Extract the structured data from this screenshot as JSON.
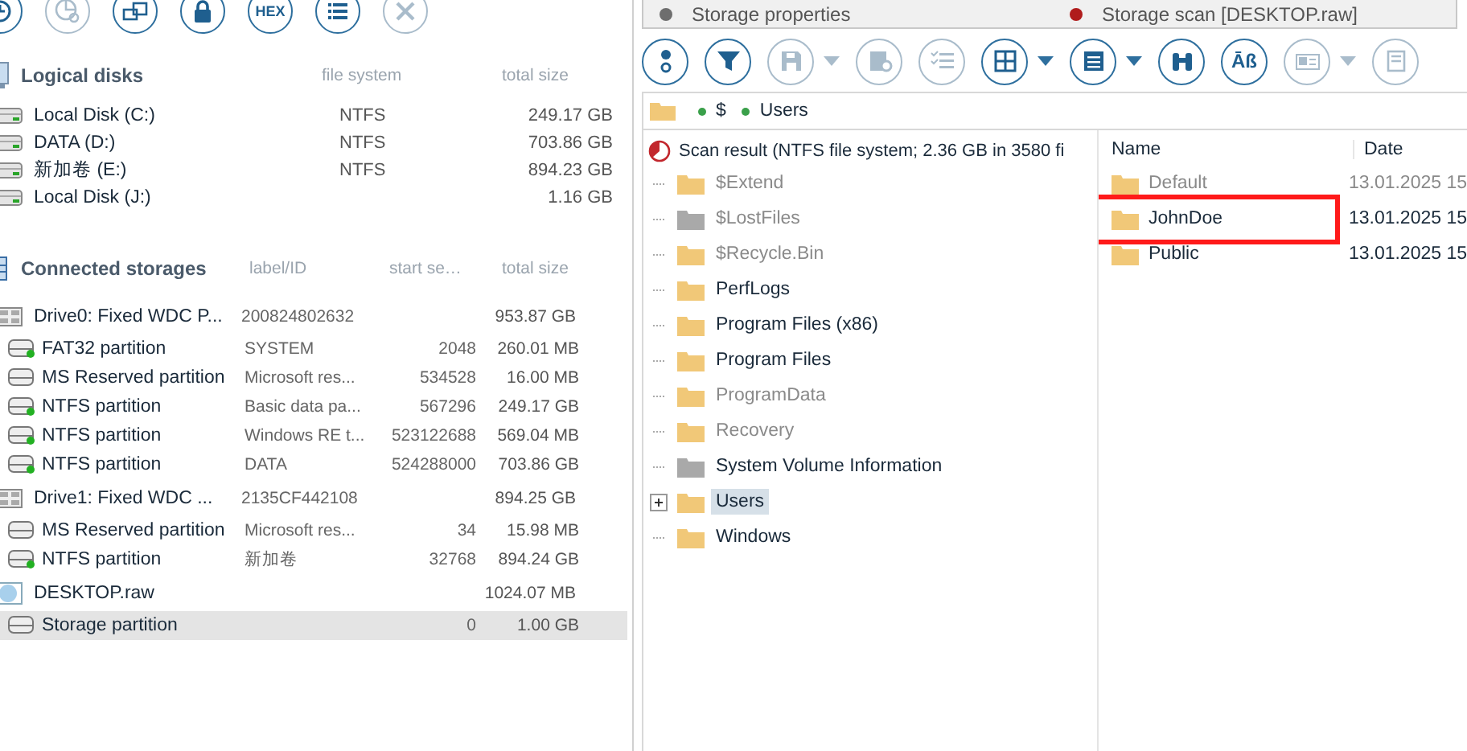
{
  "left_toolbar": [
    {
      "kind": "clock",
      "disabled": false
    },
    {
      "kind": "pie",
      "disabled": true
    },
    {
      "kind": "copy",
      "disabled": false
    },
    {
      "kind": "lock",
      "disabled": false
    },
    {
      "kind": "hex",
      "label": "HEX",
      "disabled": false
    },
    {
      "kind": "list",
      "disabled": false
    },
    {
      "kind": "close",
      "disabled": true
    }
  ],
  "logical_disks": {
    "title": "Logical disks",
    "columns": [
      "file system",
      "total size"
    ],
    "items": [
      {
        "name": "Local Disk (C:)",
        "file_system": "NTFS",
        "size": "249.17 GB"
      },
      {
        "name": "DATA (D:)",
        "file_system": "NTFS",
        "size": "703.86 GB"
      },
      {
        "name": "新加卷 (E:)",
        "file_system": "NTFS",
        "size": "894.23 GB"
      },
      {
        "name": "Local Disk (J:)",
        "size": "1.16 GB"
      }
    ]
  },
  "connected_storages": {
    "title": "Connected storages",
    "columns": [
      "label/ID",
      "start se…",
      "total size"
    ],
    "items": [
      {
        "kind": "drive",
        "name": "Drive0: Fixed WDC P...",
        "label": "200824802632",
        "size": "953.87 GB",
        "selected": false,
        "children": [
          {
            "kind": "partition",
            "name": "FAT32 partition",
            "label": "SYSTEM",
            "start": "2048",
            "size": "260.01 MB",
            "mounted": true,
            "selected": false
          },
          {
            "kind": "partition",
            "name": "MS Reserved partition",
            "label": "Microsoft res...",
            "start": "534528",
            "size": "16.00 MB",
            "mounted": false,
            "selected": false
          },
          {
            "kind": "partition",
            "name": "NTFS partition",
            "label": "Basic data pa...",
            "start": "567296",
            "size": "249.17 GB",
            "mounted": true,
            "selected": false
          },
          {
            "kind": "partition",
            "name": "NTFS partition",
            "label": "Windows RE t...",
            "start": "523122688",
            "size": "569.04 MB",
            "mounted": true,
            "selected": false
          },
          {
            "kind": "partition",
            "name": "NTFS partition",
            "label": "DATA",
            "start": "524288000",
            "size": "703.86 GB",
            "mounted": true,
            "selected": false
          }
        ]
      },
      {
        "kind": "drive",
        "name": "Drive1: Fixed WDC ...",
        "label": "2135CF442108",
        "size": "894.25 GB",
        "selected": false,
        "children": [
          {
            "kind": "partition",
            "name": "MS Reserved partition",
            "label": "Microsoft res...",
            "start": "34",
            "size": "15.98 MB",
            "mounted": false,
            "selected": false
          },
          {
            "kind": "partition",
            "name": "NTFS partition",
            "label": "新加卷",
            "start": "32768",
            "size": "894.24 GB",
            "mounted": true,
            "selected": false
          }
        ]
      },
      {
        "kind": "image",
        "name": "DESKTOP.raw",
        "size": "1024.07 MB",
        "selected": false,
        "children": [
          {
            "kind": "partition",
            "name": "Storage partition",
            "start": "0",
            "size": "1.00 GB",
            "mounted": false,
            "selected": true
          }
        ]
      }
    ]
  },
  "tabs": [
    {
      "label": "Storage properties",
      "color": "#6e6e6e"
    },
    {
      "label": "Storage scan [DESKTOP.raw]",
      "color": "#b01c1c"
    }
  ],
  "right_toolbar": [
    {
      "kind": "info",
      "disabled": false
    },
    {
      "kind": "filter",
      "disabled": false
    },
    {
      "kind": "save",
      "disabled": true,
      "dropdown": true
    },
    {
      "kind": "settings",
      "disabled": true
    },
    {
      "kind": "checklist",
      "disabled": true
    },
    {
      "kind": "grid",
      "disabled": false,
      "dropdown": true
    },
    {
      "kind": "panel",
      "disabled": false,
      "dropdown": true
    },
    {
      "kind": "binoculars",
      "disabled": false
    },
    {
      "kind": "text",
      "label": "Āß",
      "disabled": false
    },
    {
      "kind": "picture",
      "disabled": true,
      "dropdown": true
    },
    {
      "kind": "document",
      "disabled": true
    }
  ],
  "path": [
    "$",
    "Users"
  ],
  "tree": {
    "root": "Scan result (NTFS file system; 2.36 GB in 3580 fi",
    "items": [
      {
        "name": "$Extend",
        "kind": "folder",
        "dimmed": true,
        "expandable": false,
        "selected": false
      },
      {
        "name": "$LostFiles",
        "kind": "system",
        "dimmed": true,
        "expandable": false,
        "selected": false
      },
      {
        "name": "$Recycle.Bin",
        "kind": "folder",
        "dimmed": true,
        "expandable": false,
        "selected": false
      },
      {
        "name": "PerfLogs",
        "kind": "folder",
        "dimmed": false,
        "expandable": false,
        "selected": false
      },
      {
        "name": "Program Files (x86)",
        "kind": "folder",
        "dimmed": false,
        "expandable": false,
        "selected": false
      },
      {
        "name": "Program Files",
        "kind": "folder",
        "dimmed": false,
        "expandable": false,
        "selected": false
      },
      {
        "name": "ProgramData",
        "kind": "folder",
        "dimmed": true,
        "expandable": false,
        "selected": false
      },
      {
        "name": "Recovery",
        "kind": "folder",
        "dimmed": true,
        "expandable": false,
        "selected": false
      },
      {
        "name": "System Volume Information",
        "kind": "system",
        "dimmed": false,
        "expandable": false,
        "selected": false
      },
      {
        "name": "Users",
        "kind": "folder",
        "dimmed": false,
        "expandable": true,
        "selected": true
      },
      {
        "name": "Windows",
        "kind": "folder",
        "dimmed": false,
        "expandable": false,
        "selected": false
      }
    ]
  },
  "file_list": {
    "columns": [
      "Name",
      "Date"
    ],
    "rows": [
      {
        "name": "Default",
        "date": "13.01.2025 15",
        "dimmed": true,
        "highlighted": false
      },
      {
        "name": "JohnDoe",
        "date": "13.01.2025 15",
        "dimmed": false,
        "highlighted": true
      },
      {
        "name": "Public",
        "date": "13.01.2025 15",
        "dimmed": false,
        "highlighted": false
      }
    ]
  }
}
